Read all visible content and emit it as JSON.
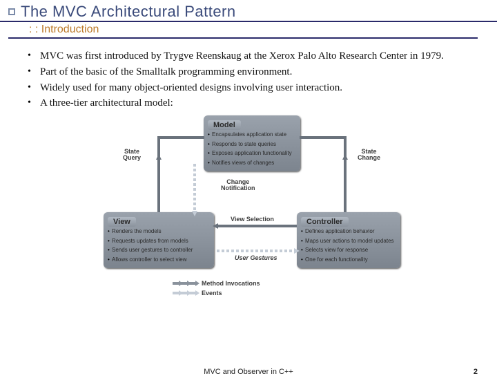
{
  "title": "The MVC Architectural Pattern",
  "subtitle": ": : Introduction",
  "bullets": [
    "MVC was first introduced by Trygve Reenskaug at the Xerox Palo Alto Research Center in 1979.",
    "Part of the basic of the Smalltalk programming environment.",
    "Widely used for many object-oriented designs involving user interaction.",
    "A three-tier architectural model:"
  ],
  "diagram": {
    "model": {
      "name": "Model",
      "items": [
        "Encapsulates application state",
        "Responds to state queries",
        "Exposes application functionality",
        "Notifies views of changes"
      ]
    },
    "view": {
      "name": "View",
      "items": [
        "Renders the models",
        "Requests updates from models",
        "Sends user gestures to controller",
        "Allows controller to select view"
      ]
    },
    "controller": {
      "name": "Controller",
      "items": [
        "Defines application behavior",
        "Maps user actions to model updates",
        "Selects view for response",
        "One for each functionality"
      ]
    },
    "labels": {
      "state_query": "State\nQuery",
      "state_change": "State\nChange",
      "change_notification": "Change\nNotification",
      "view_selection": "View Selection",
      "user_gestures": "User Gestures"
    },
    "legend": {
      "method": "Method Invocations",
      "events": "Events"
    }
  },
  "footer": {
    "center": "MVC and Observer in C++",
    "page": "2"
  }
}
